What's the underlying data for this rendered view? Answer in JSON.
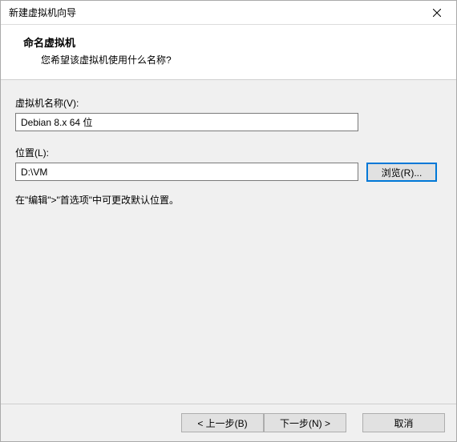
{
  "window": {
    "title": "新建虚拟机向导"
  },
  "header": {
    "title": "命名虚拟机",
    "subtitle": "您希望该虚拟机使用什么名称?"
  },
  "form": {
    "name_label": "虚拟机名称(V):",
    "name_value": "Debian 8.x 64 位",
    "location_label": "位置(L):",
    "location_value": "D:\\VM",
    "browse_label": "浏览(R)...",
    "hint": "在\"编辑\">\"首选项\"中可更改默认位置。"
  },
  "footer": {
    "back": "< 上一步(B)",
    "next": "下一步(N) >",
    "cancel": "取消"
  }
}
